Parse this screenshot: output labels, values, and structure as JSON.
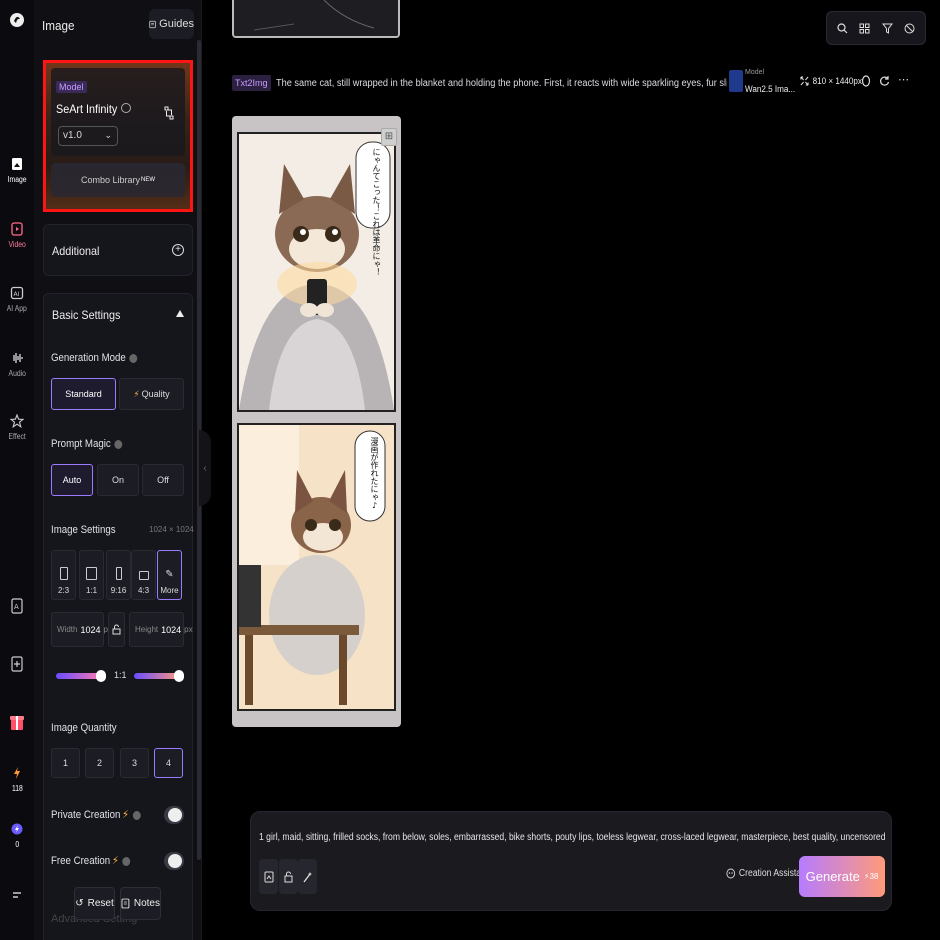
{
  "rail": {
    "items": [
      {
        "label": "Image"
      },
      {
        "label": "Video"
      },
      {
        "label": "AI App"
      },
      {
        "label": "Audio"
      },
      {
        "label": "Effect"
      }
    ],
    "credits": "118",
    "boost": "0"
  },
  "panel": {
    "title": "Image",
    "guides_label": "Guides",
    "model": {
      "tag": "Model",
      "name": "SeArt Infinity",
      "version": "v1.0",
      "combo_library": "Combo Library",
      "combo_badge": "NEW"
    },
    "additional": "Additional",
    "basic_settings": "Basic Settings",
    "generation_mode": {
      "label": "Generation Mode",
      "options": [
        "Standard",
        "Quality"
      ],
      "selected": "Standard"
    },
    "prompt_magic": {
      "label": "Prompt Magic",
      "options": [
        "Auto",
        "On",
        "Off"
      ],
      "selected": "Auto"
    },
    "image_settings": {
      "label": "Image Settings",
      "size": "1024 × 1024",
      "ratios": [
        "2:3",
        "1:1",
        "9:16",
        "4:3",
        "More"
      ],
      "width_label": "Width",
      "width_value": "1024",
      "height_label": "Height",
      "height_value": "1024",
      "unit": "px",
      "ratio_label": "1:1"
    },
    "image_quantity": {
      "label": "Image Quantity",
      "options": [
        "1",
        "2",
        "3",
        "4"
      ],
      "selected": "4"
    },
    "private_creation": "Private Creation",
    "free_creation": "Free Creation",
    "advanced": "Advanced Setting",
    "reset": "Reset",
    "notes": "Notes"
  },
  "result": {
    "badge": "Txt2Img",
    "prompt_preview": "The same cat, still wrapped in the blanket and holding the phone. First, it reacts with wide sparkling eyes, fur slightly ruffled, glowin...",
    "model_caption": "Model",
    "model_name": "Wan2.5 Ima...",
    "resolution": "810 × 1440px",
    "bubble1": "にゃんてこった！これは革命にゃ！",
    "bubble2": "漫画が作れたにゃ♪"
  },
  "prompt": {
    "text": "1 girl, maid, sitting, frilled socks, from below, soles, embarrassed, bike shorts, pouty lips, toeless legwear, cross-laced legwear, masterpiece, best quality, uncensored",
    "assistant": "Creation Assistant",
    "generate": "Generate",
    "cost": "38"
  },
  "colors": {
    "accent": "#9b7cff",
    "highlight_box": "#ff1414",
    "generate_gradient_start": "#b67cff",
    "generate_gradient_end": "#ff9a7a"
  }
}
